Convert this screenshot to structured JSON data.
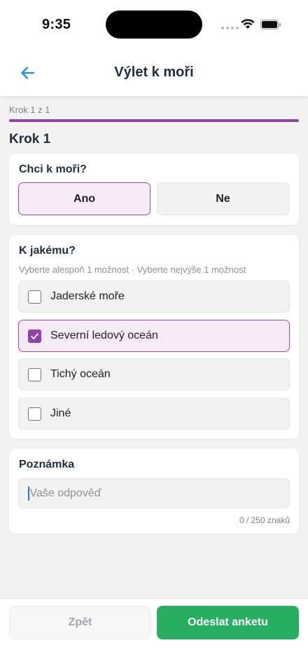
{
  "status_bar": {
    "time": "9:35"
  },
  "header": {
    "title": "Výlet k moři",
    "back_icon": "arrow-left-icon"
  },
  "progress": {
    "step_counter": "Krok 1 z 1",
    "fraction": 1.0
  },
  "step": {
    "title": "Krok 1"
  },
  "question1": {
    "title": "Chci k moři?",
    "options": [
      {
        "label": "Ano",
        "selected": true
      },
      {
        "label": "Ne",
        "selected": false
      }
    ]
  },
  "question2": {
    "title": "K jakému?",
    "hint": "Vyberte alespoň 1 možnost · Vyberte nejvýše 1 možnost",
    "options": [
      {
        "label": "Jaderské moře",
        "checked": false
      },
      {
        "label": "Severní ledový oceán",
        "checked": true
      },
      {
        "label": "Tichý oceán",
        "checked": false
      },
      {
        "label": "Jiné",
        "checked": false
      }
    ]
  },
  "question3": {
    "title": "Poznámka",
    "placeholder": "Vaše odpověď",
    "char_count": "0 / 250 znaků"
  },
  "footer": {
    "back_label": "Zpět",
    "submit_label": "Odeslat anketu"
  },
  "colors": {
    "accent": "#8e44a6",
    "submit": "#27ae60",
    "back_arrow": "#2f8fd8"
  }
}
